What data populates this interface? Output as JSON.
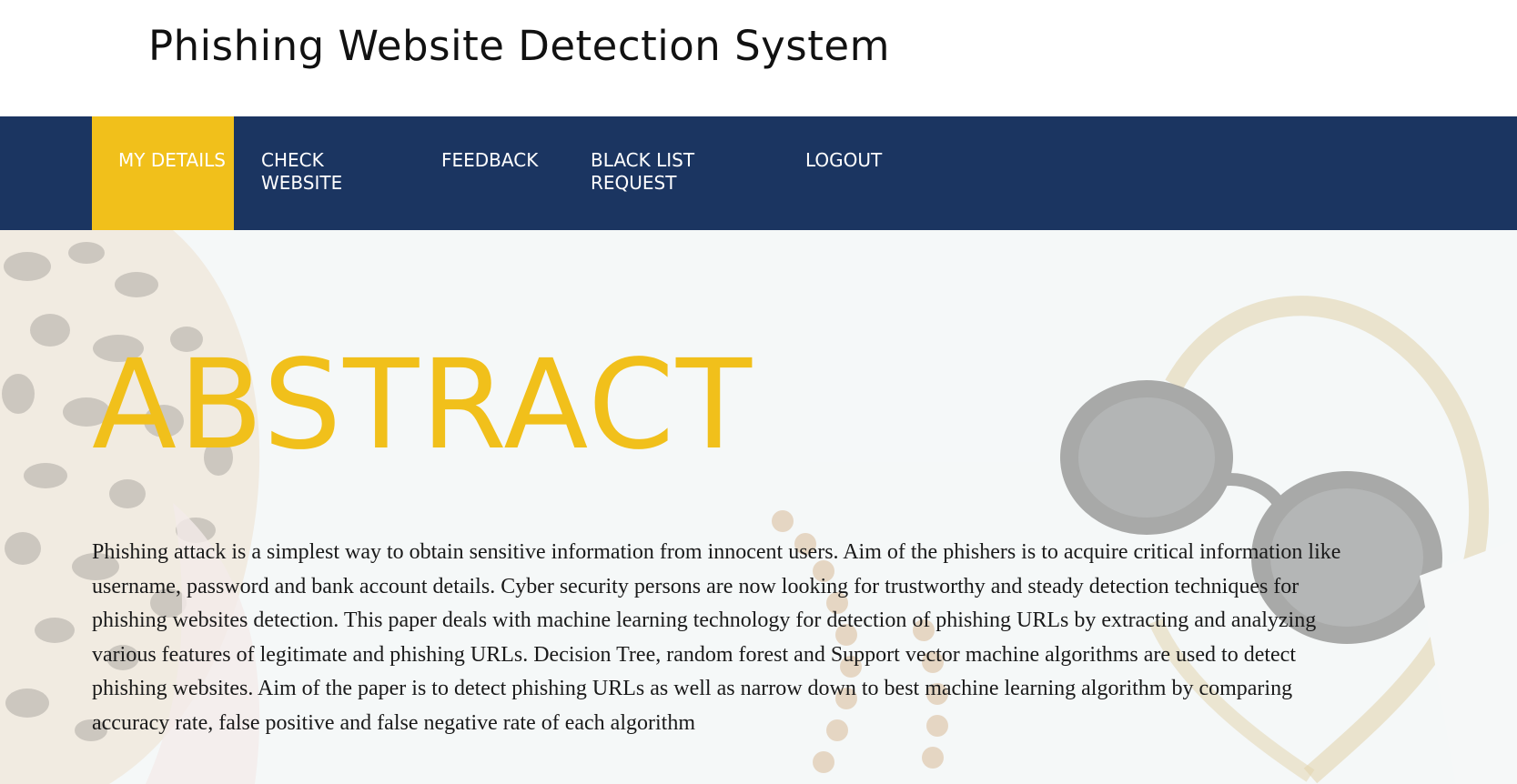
{
  "header": {
    "title": "Phishing Website Detection System"
  },
  "nav": {
    "items": [
      {
        "label": "MY DETAILS",
        "active": true
      },
      {
        "label": "CHECK WEBSITE",
        "active": false
      },
      {
        "label": "FEEDBACK",
        "active": false
      },
      {
        "label": "BLACK LIST REQUEST",
        "active": false
      },
      {
        "label": "LOGOUT",
        "active": false
      }
    ]
  },
  "hero": {
    "heading": "ABSTRACT",
    "paragraph": "Phishing attack is a simplest way to obtain sensitive information from innocent users. Aim of the phishers is to acquire critical information like username, password and bank account details. Cyber security persons are now looking for trustworthy and steady detection techniques for phishing websites detection. This paper deals with machine learning technology for detection of phishing URLs by extracting and analyzing various features of legitimate and phishing URLs. Decision Tree, random forest and Support vector machine algorithms are used to detect phishing websites. Aim of the paper is to detect phishing URLs as well as narrow down to best machine learning algorithm by comparing accuracy rate, false positive and false negative rate of each algorithm"
  },
  "colors": {
    "accent": "#f1c01b",
    "nav_background": "#1b3561",
    "header_background": "#ffffff",
    "text": "#1a1a1a"
  }
}
